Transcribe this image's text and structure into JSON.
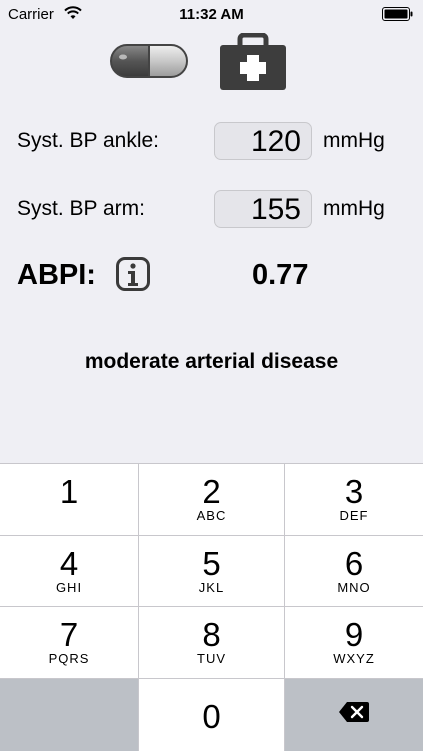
{
  "status_bar": {
    "carrier": "Carrier",
    "time": "11:32 AM",
    "icons": [
      "wifi-icon",
      "battery-icon"
    ]
  },
  "toolbar": {
    "icons": [
      "pill-icon",
      "first-aid-kit-icon"
    ]
  },
  "form": {
    "ankle_label": "Syst. BP ankle:",
    "ankle_value": "120",
    "ankle_unit": "mmHg",
    "arm_label": "Syst. BP arm:",
    "arm_value": "155",
    "arm_unit": "mmHg"
  },
  "result": {
    "abpi_label": "ABPI:",
    "info_icon": "info-icon",
    "abpi_value": "0.77",
    "diagnosis": "moderate arterial disease"
  },
  "keypad": {
    "keys": [
      {
        "num": "1",
        "sub": ""
      },
      {
        "num": "2",
        "sub": "ABC"
      },
      {
        "num": "3",
        "sub": "DEF"
      },
      {
        "num": "4",
        "sub": "GHI"
      },
      {
        "num": "5",
        "sub": "JKL"
      },
      {
        "num": "6",
        "sub": "MNO"
      },
      {
        "num": "7",
        "sub": "PQRS"
      },
      {
        "num": "8",
        "sub": "TUV"
      },
      {
        "num": "9",
        "sub": "WXYZ"
      },
      {
        "num": "",
        "sub": ""
      },
      {
        "num": "0",
        "sub": ""
      },
      {
        "num": "",
        "sub": ""
      }
    ],
    "backspace_icon": "backspace-icon"
  }
}
